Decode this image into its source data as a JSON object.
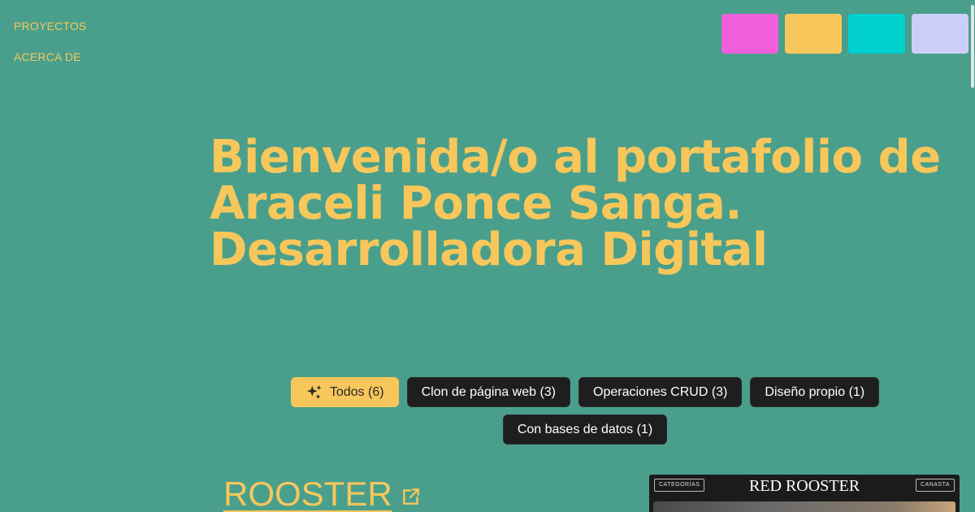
{
  "nav": {
    "projects": "PROYECTOS",
    "about": "ACERCA DE"
  },
  "theme_swatches": [
    {
      "name": "pink",
      "color": "#f25fdc"
    },
    {
      "name": "yellow",
      "color": "#f7c75b"
    },
    {
      "name": "cyan",
      "color": "#00d0d0"
    },
    {
      "name": "lavender",
      "color": "#ccd0f7"
    }
  ],
  "hero": {
    "line1": "Bienvenida/o al portafolio de",
    "line2": "Araceli Ponce Sanga.",
    "line3": "Desarrolladora Digital"
  },
  "filters": [
    {
      "label": "Todos (6)",
      "active": true,
      "icon": "sparkles-icon"
    },
    {
      "label": "Clon de página web (3)",
      "active": false
    },
    {
      "label": "Operaciones CRUD (3)",
      "active": false
    },
    {
      "label": "Diseño propio (1)",
      "active": false
    },
    {
      "label": "Con bases de datos (1)",
      "active": false
    }
  ],
  "project": {
    "title": "ROOSTER",
    "link_icon": "external-link-icon",
    "preview": {
      "brand": "RED ROOSTER",
      "left_button": "CATEGORÍAS",
      "right_button": "CANASTA"
    }
  },
  "colors": {
    "background": "#499f8c",
    "accent": "#f7c75b",
    "chip": "#1e1e1e"
  }
}
